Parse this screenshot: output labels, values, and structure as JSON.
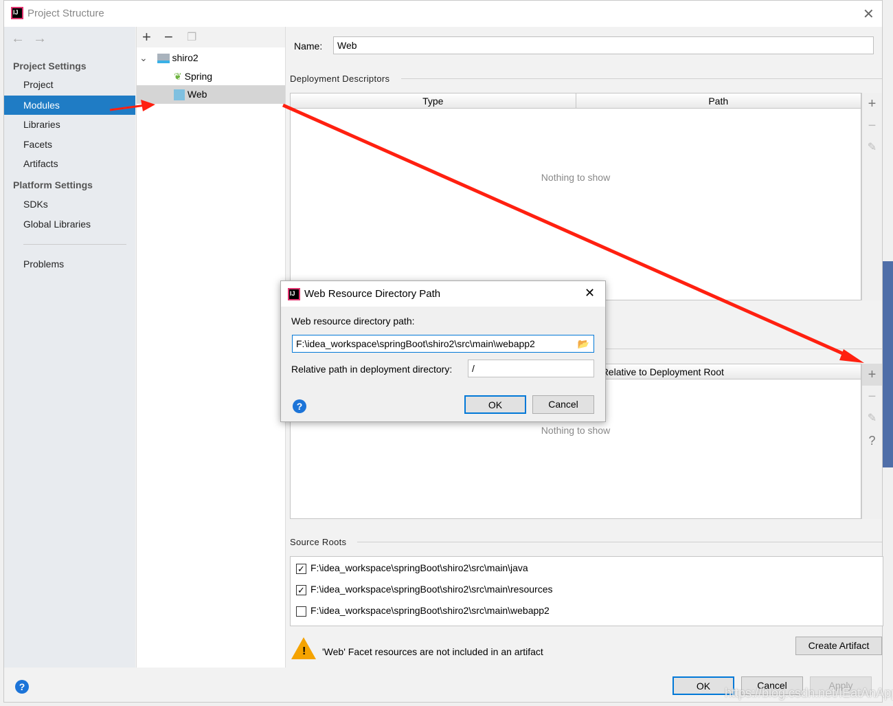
{
  "window": {
    "title": "Project Structure"
  },
  "sidebar": {
    "project_settings": "Project Settings",
    "platform_settings": "Platform Settings",
    "items": [
      {
        "label": "Project"
      },
      {
        "label": "Modules"
      },
      {
        "label": "Libraries"
      },
      {
        "label": "Facets"
      },
      {
        "label": "Artifacts"
      },
      {
        "label": "SDKs"
      },
      {
        "label": "Global Libraries"
      },
      {
        "label": "Problems"
      }
    ],
    "selected": "Modules"
  },
  "tree": {
    "nodes": [
      {
        "label": "shiro2"
      },
      {
        "label": "Spring"
      },
      {
        "label": "Web"
      }
    ]
  },
  "main": {
    "name_label": "Name:",
    "name_value": "Web",
    "deployment_descriptors": "Deployment Descriptors",
    "dd_columns": [
      "Type",
      "Path"
    ],
    "nothing": "Nothing to show",
    "web_dirs_column": "Path Relative to Deployment Root",
    "source_roots": "Source Roots",
    "roots": [
      {
        "path": "F:\\idea_workspace\\springBoot\\shiro2\\src\\main\\java",
        "checked": true
      },
      {
        "path": "F:\\idea_workspace\\springBoot\\shiro2\\src\\main\\resources",
        "checked": true
      },
      {
        "path": "F:\\idea_workspace\\springBoot\\shiro2\\src\\main\\webapp2",
        "checked": false
      }
    ],
    "warning": "'Web' Facet resources are not included in an artifact",
    "create_artifact": "Create Artifact"
  },
  "footer": {
    "ok": "OK",
    "cancel": "Cancel",
    "apply": "Apply"
  },
  "dialog": {
    "title": "Web Resource Directory Path",
    "dir_label": "Web resource directory path:",
    "dir_value": "F:\\idea_workspace\\springBoot\\shiro2\\src\\main\\webapp2",
    "rel_label": "Relative path in deployment directory:",
    "rel_value": "/",
    "ok": "OK",
    "cancel": "Cancel"
  },
  "watermark": "https://blog.csdn.net/IEatAnApple",
  "colors": {
    "selection": "#1f7cc5",
    "annotation_arrow": "#ff2010"
  }
}
